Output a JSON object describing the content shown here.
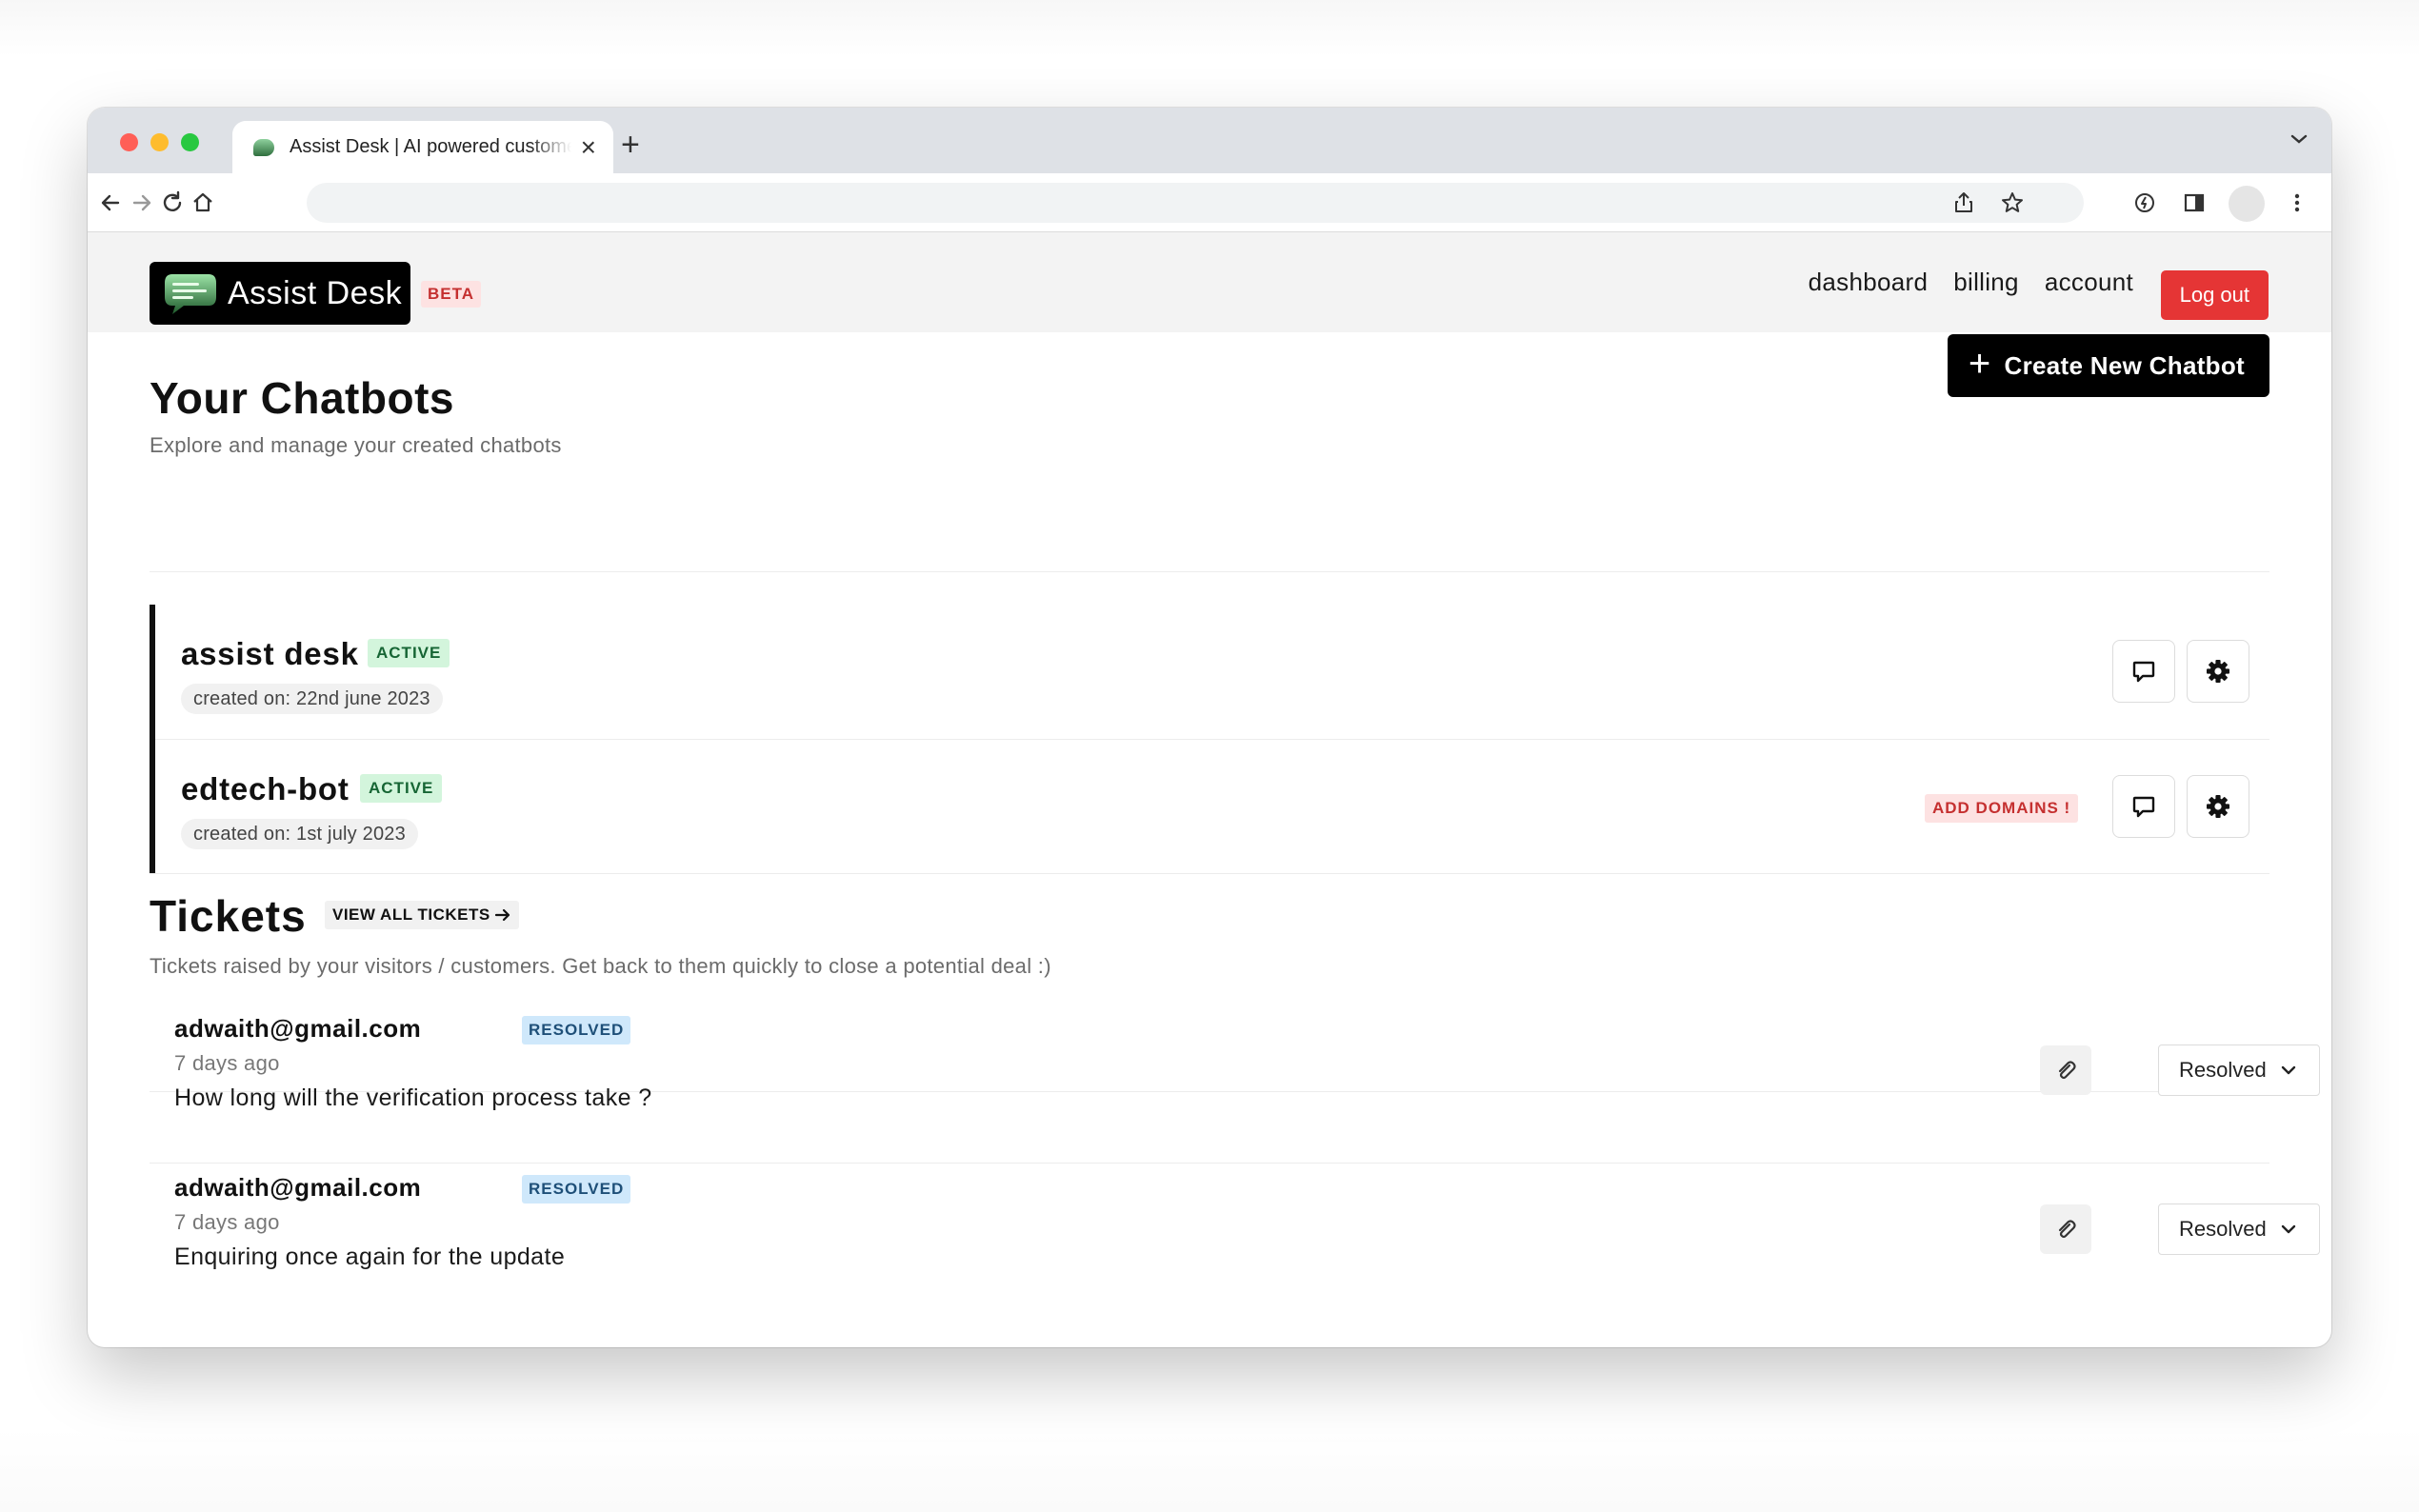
{
  "browser": {
    "tab_title": "Assist Desk | AI powered customer support",
    "new_tab_symbol": "+",
    "close_symbol": "×"
  },
  "header": {
    "logo_text": "Assist Desk",
    "beta_label": "BETA",
    "nav": [
      "dashboard",
      "billing",
      "account"
    ],
    "logout_label": "Log out"
  },
  "chatbots": {
    "title": "Your Chatbots",
    "subtitle": "Explore and manage your created chatbots",
    "create_label": "Create New Chatbot",
    "items": [
      {
        "name": "assist desk",
        "status": "ACTIVE",
        "created": "created on: 22nd june 2023",
        "warning": ""
      },
      {
        "name": "edtech-bot",
        "status": "ACTIVE",
        "created": "created on: 1st july 2023",
        "warning": "ADD DOMAINS !"
      }
    ]
  },
  "tickets": {
    "title": "Tickets",
    "view_all_label": "VIEW ALL TICKETS",
    "subtitle": "Tickets raised by your visitors / customers. Get back to them quickly to close a potential deal :)",
    "items": [
      {
        "email": "adwaith@gmail.com",
        "status": "RESOLVED",
        "time": "7 days ago",
        "message": "How long will the verification process take ?",
        "select_value": "Resolved"
      },
      {
        "email": "adwaith@gmail.com",
        "status": "RESOLVED",
        "time": "7 days ago",
        "message": "Enquiring once again for the update",
        "select_value": "Resolved"
      }
    ]
  },
  "colors": {
    "logout_bg": "#e53535",
    "active_badge_bg": "#d3f5dc",
    "resolved_badge_bg": "#cfe8fb",
    "warning_badge_bg": "#fde2e2"
  }
}
